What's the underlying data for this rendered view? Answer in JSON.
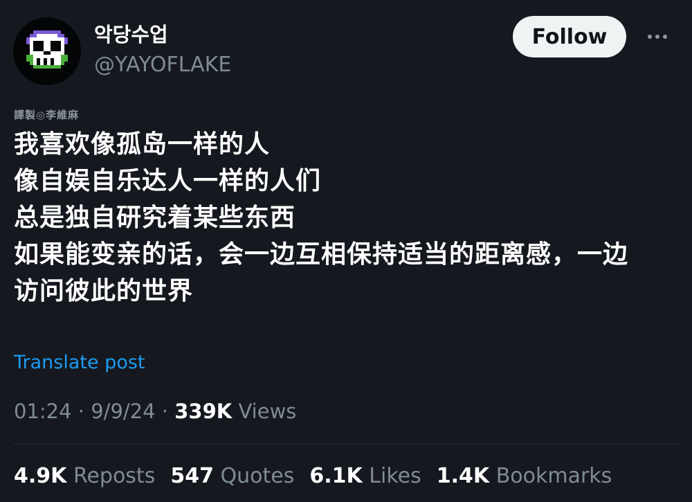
{
  "author": {
    "display_name": "악당수업",
    "handle": "@YAYOFLAKE",
    "avatar_icon": "pixel-skull-icon"
  },
  "actions": {
    "follow_label": "Follow",
    "more_icon": "more-horizontal-icon"
  },
  "post": {
    "watermark": "譯製◎李維麻",
    "lines": [
      "我喜欢像孤岛一样的人",
      "像自娱自乐达人一样的人们",
      "总是独自研究着某些东西",
      "如果能变亲的话，会一边互相保持适当的距离感，一边",
      "访问彼此的世界"
    ],
    "translate_label": "Translate post"
  },
  "meta": {
    "time": "01:24",
    "separator": "·",
    "date": "9/9/24",
    "views_count": "339K",
    "views_label": "Views"
  },
  "stats": [
    {
      "count": "4.9K",
      "label": "Reposts"
    },
    {
      "count": "547",
      "label": "Quotes"
    },
    {
      "count": "6.1K",
      "label": "Likes"
    },
    {
      "count": "1.4K",
      "label": "Bookmarks"
    }
  ],
  "colors": {
    "background": "#15181e",
    "link": "#1d9bf0",
    "muted": "#7f8b95",
    "skull_purple": "#7b5ad6",
    "skull_green": "#4caf3c"
  }
}
